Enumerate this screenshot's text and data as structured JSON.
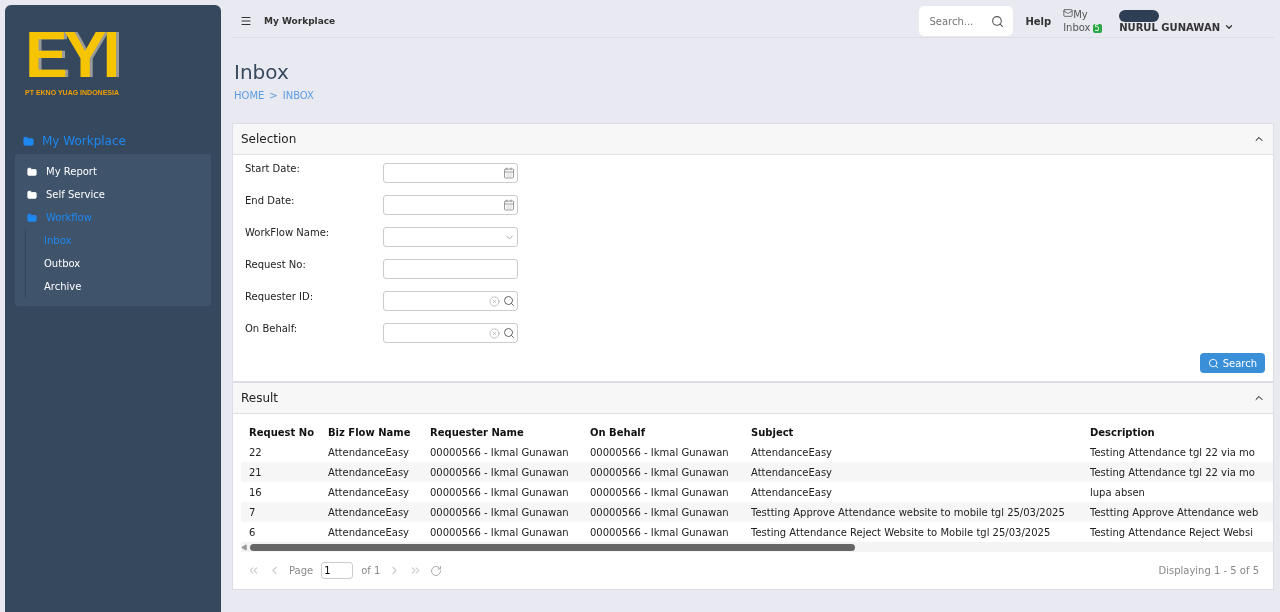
{
  "logo": {
    "mark": "EYI",
    "company": "PT EKNO YUAG INDONESIA"
  },
  "sidebar": {
    "title": "My Workplace",
    "items": [
      {
        "label": "My Report",
        "selected": false
      },
      {
        "label": "Self Service",
        "selected": false
      },
      {
        "label": "Workflow",
        "selected": true,
        "children": [
          {
            "label": "Inbox",
            "selected": true
          },
          {
            "label": "Outbox",
            "selected": false
          },
          {
            "label": "Archive",
            "selected": false
          }
        ]
      }
    ]
  },
  "topbar": {
    "title": "My Workplace",
    "search": {
      "placeholder": "Search..."
    },
    "help": "Help",
    "inbox": {
      "label": "My Inbox",
      "count": "5"
    },
    "user": "NURUL GUNAWAN"
  },
  "page": {
    "title": "Inbox",
    "breadcrumb": [
      "HOME",
      "INBOX"
    ],
    "breadcrumb_separator": ">"
  },
  "selection": {
    "title": "Selection",
    "expanded": true,
    "fields": [
      {
        "label": "Start Date:",
        "kind": "date"
      },
      {
        "label": "End Date:",
        "kind": "date"
      },
      {
        "label": "WorkFlow Name:",
        "kind": "select"
      },
      {
        "label": "Request No:",
        "kind": "text"
      },
      {
        "label": "Requester ID:",
        "kind": "lookup"
      },
      {
        "label": "On Behalf:",
        "kind": "lookup"
      }
    ],
    "button": "Search"
  },
  "result": {
    "title": "Result",
    "expanded": true,
    "table": {
      "columns": [
        "Request No",
        "Biz Flow Name",
        "Requester Name",
        "On Behalf",
        "Subject",
        "Description"
      ],
      "rows": [
        [
          "22",
          "AttendanceEasy",
          "00000566 - Ikmal Gunawan",
          "00000566 - Ikmal Gunawan",
          "AttendanceEasy",
          "Testing Attendance tgl 22 via mo"
        ],
        [
          "21",
          "AttendanceEasy",
          "00000566 - Ikmal Gunawan",
          "00000566 - Ikmal Gunawan",
          "AttendanceEasy",
          "Testing Attendance tgl 22 via mo"
        ],
        [
          "16",
          "AttendanceEasy",
          "00000566 - Ikmal Gunawan",
          "00000566 - Ikmal Gunawan",
          "AttendanceEasy",
          "lupa absen"
        ],
        [
          "7",
          "AttendanceEasy",
          "00000566 - Ikmal Gunawan",
          "00000566 - Ikmal Gunawan",
          "Testting Approve Attendance website to mobile tgl 25/03/2025",
          "Testting Approve Attendance web"
        ],
        [
          "6",
          "AttendanceEasy",
          "00000566 - Ikmal Gunawan",
          "00000566 - Ikmal Gunawan",
          "Testing Attendance Reject Website to Mobile tgl 25/03/2025",
          "Testing Attendance Reject Websi"
        ]
      ]
    },
    "pager": {
      "page_label": "Page",
      "page": "1",
      "of": "of 1",
      "display": "Displaying 1 - 5 of 5"
    }
  }
}
